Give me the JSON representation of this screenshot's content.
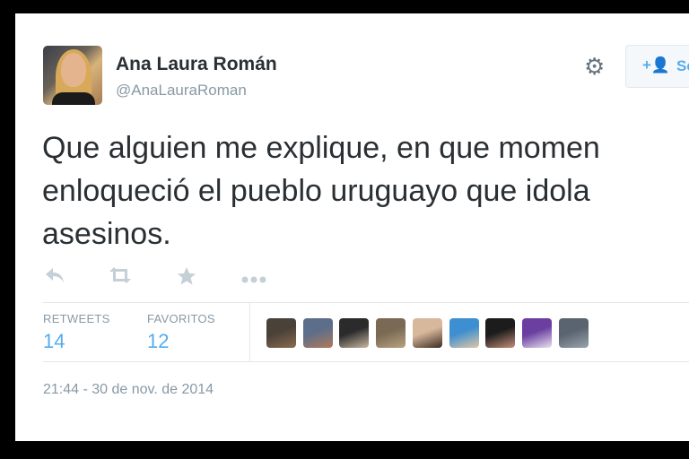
{
  "header": {
    "display_name": "Ana Laura Román",
    "handle": "@AnaLauraRoman",
    "follow_icon": "add-user-icon",
    "follow_label": "Se",
    "settings_icon": "gear-icon"
  },
  "tweet": {
    "lines": [
      "Que alguien me explique, en que momen",
      "enloqueció el pueblo uruguayo que idola",
      "asesinos."
    ]
  },
  "actions": [
    "reply-icon",
    "retweet-icon",
    "favorite-icon",
    "more-icon"
  ],
  "stats": {
    "retweets_label": "RETWEETS",
    "retweets_value": "14",
    "favorites_label": "FAVORITOS",
    "favorites_value": "12"
  },
  "favoriters": [
    {
      "name": "favoriter-avatar-1",
      "colors": [
        "#4a4238",
        "#8a6a4e"
      ]
    },
    {
      "name": "favoriter-avatar-2",
      "colors": [
        "#5d6e8a",
        "#b07a5a"
      ]
    },
    {
      "name": "favoriter-avatar-3",
      "colors": [
        "#2b2b2b",
        "#c9b7a3"
      ]
    },
    {
      "name": "favoriter-avatar-4",
      "colors": [
        "#7a6a55",
        "#b9a27f"
      ]
    },
    {
      "name": "favoriter-avatar-5",
      "colors": [
        "#d8b89c",
        "#3a2a20"
      ]
    },
    {
      "name": "favoriter-avatar-6",
      "colors": [
        "#3d8fd1",
        "#e1c7a6"
      ]
    },
    {
      "name": "favoriter-avatar-7",
      "colors": [
        "#1c1c1c",
        "#c48e7a"
      ]
    },
    {
      "name": "favoriter-avatar-8",
      "colors": [
        "#6b3fa0",
        "#e8e0f0"
      ]
    },
    {
      "name": "favoriter-avatar-9",
      "colors": [
        "#5a6470",
        "#9aa4ad"
      ]
    }
  ],
  "timestamp": "21:44 - 30 de nov. de 2014"
}
